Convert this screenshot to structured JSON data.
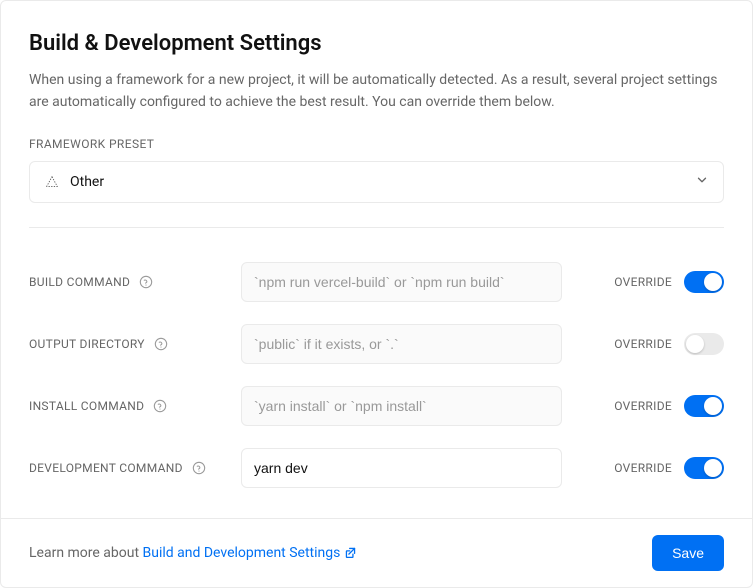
{
  "header": {
    "title": "Build & Development Settings",
    "description": "When using a framework for a new project, it will be automatically detected. As a result, several project settings are automatically configured to achieve the best result. You can override them below."
  },
  "framework_preset": {
    "label": "FRAMEWORK PRESET",
    "selected": "Other"
  },
  "override_label": "OVERRIDE",
  "rows": {
    "build": {
      "label": "BUILD COMMAND",
      "placeholder": "`npm run vercel-build` or `npm run build`",
      "value": "",
      "override": true
    },
    "output": {
      "label": "OUTPUT DIRECTORY",
      "placeholder": "`public` if it exists, or `.`",
      "value": "",
      "override": false
    },
    "install": {
      "label": "INSTALL COMMAND",
      "placeholder": "`yarn install` or `npm install`",
      "value": "",
      "override": true
    },
    "dev": {
      "label": "DEVELOPMENT COMMAND",
      "placeholder": "",
      "value": "yarn dev",
      "override": true
    }
  },
  "footer": {
    "learn_prefix": "Learn more about ",
    "link_text": "Build and Development Settings",
    "save_label": "Save"
  }
}
